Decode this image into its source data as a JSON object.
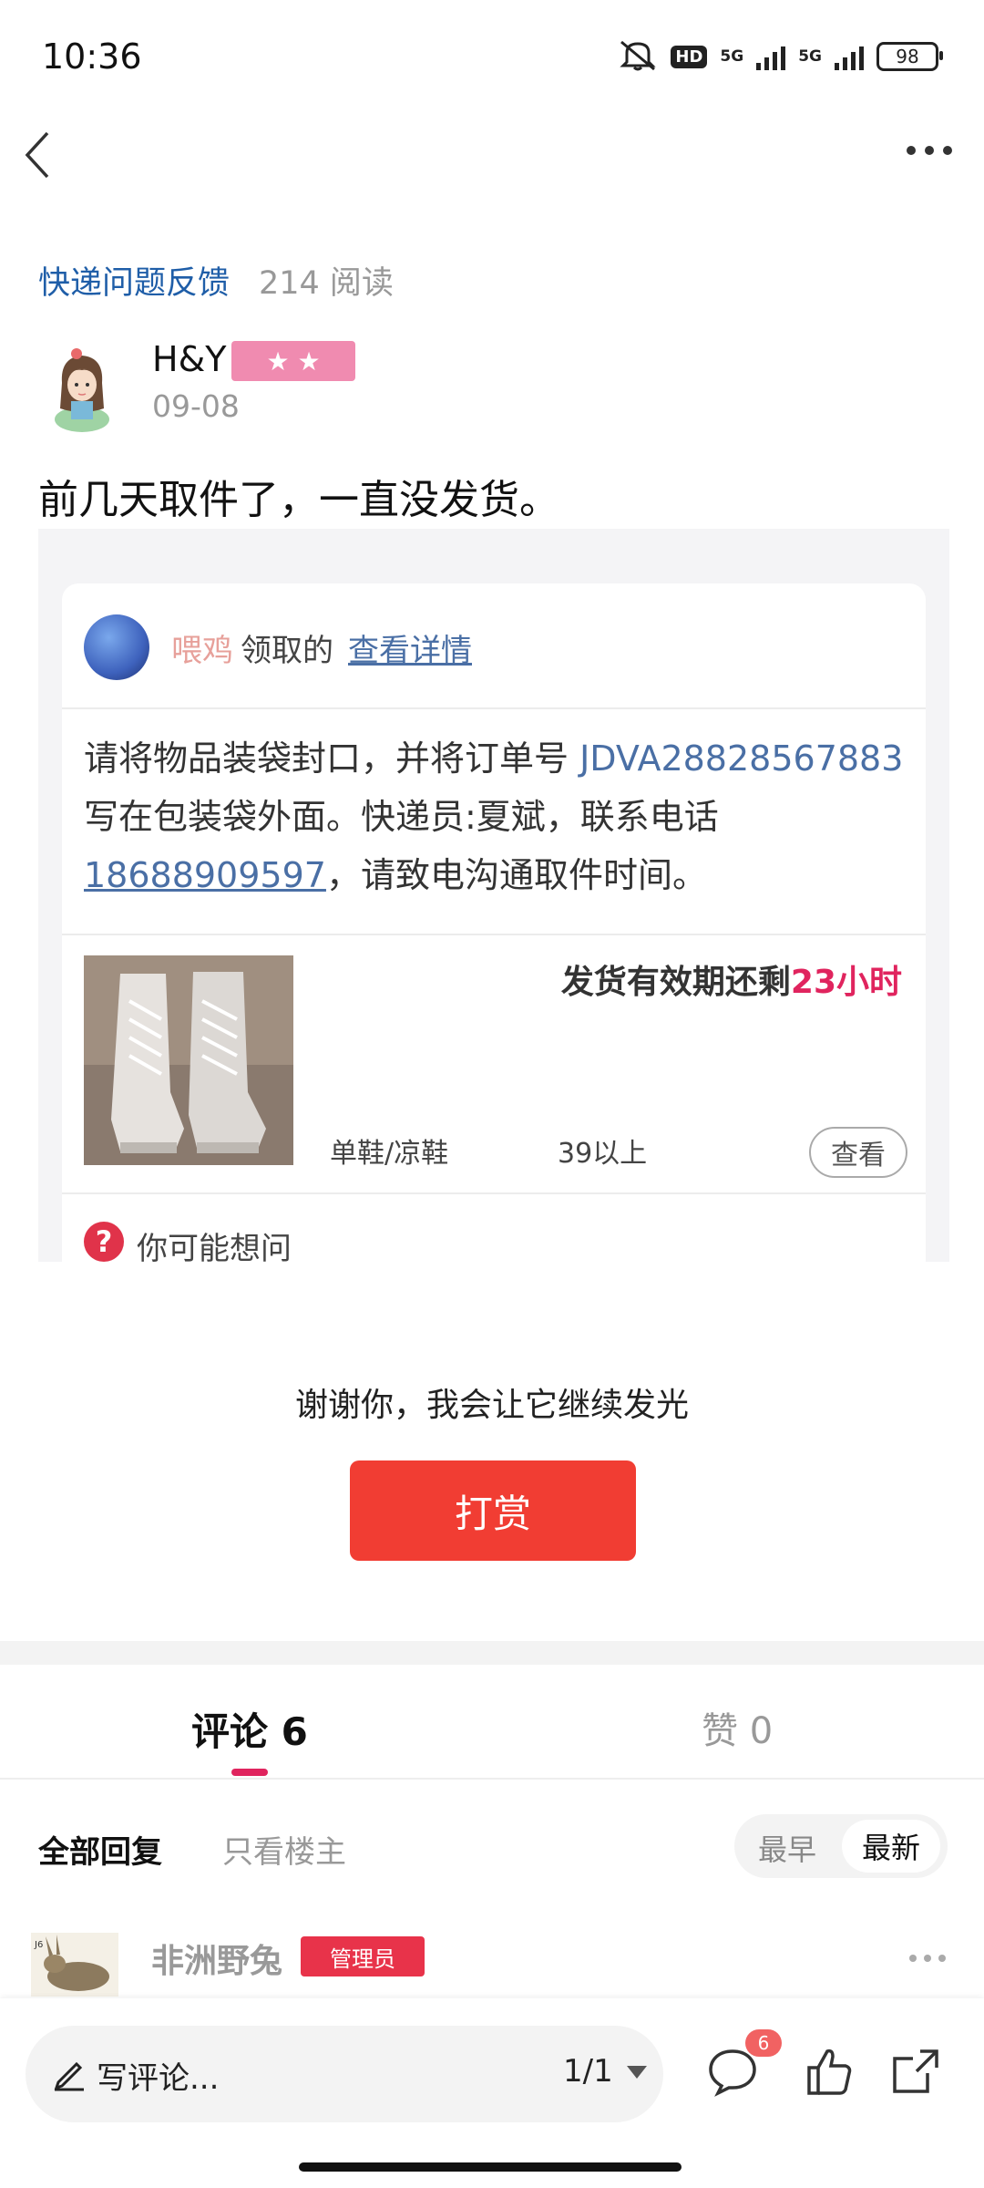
{
  "status_bar": {
    "time": "10:36",
    "hd_label": "HD",
    "net1": "5G",
    "net2": "5G",
    "battery": "98",
    "icons": [
      "mute-icon",
      "signal-icon",
      "battery-icon"
    ]
  },
  "post": {
    "topic": "快递问题反馈",
    "reads": "214 阅读",
    "author": "H&Y",
    "level_stars": "★ ★",
    "date": "09-08",
    "text": "前几天取件了，一直没发货。"
  },
  "card": {
    "claimer": "喂鸡",
    "claimed": "领取的",
    "detail_link": "查看详情",
    "instr_a": "请将物品装袋封口，并将订单号 ",
    "order_no": "JDVA28828567883",
    "instr_b": " 写在包装袋外面。快递员:夏斌，联系电话",
    "phone": "18688909597",
    "instr_c": "，请致电沟通取件时间。",
    "valid_prefix": "发货有效期还剩",
    "valid_time": "23小时",
    "category": "单鞋/凉鞋",
    "size": "39以上",
    "view_btn": "查看",
    "ask": "你可能想问"
  },
  "reward": {
    "thanks": "谢谢你，我会让它继续发光",
    "button": "打赏"
  },
  "tabs": {
    "comments": "评论 6",
    "likes": "赞 0"
  },
  "filters": {
    "all": "全部回复",
    "op_only": "只看楼主",
    "oldest": "最早",
    "newest": "最新"
  },
  "comment": {
    "name": "非洲野兔",
    "badge": "管理员"
  },
  "bottom": {
    "placeholder": "写评论...",
    "page": "1/1",
    "comment_count": "6"
  },
  "colors": {
    "accent": "#e0245e",
    "tip_button": "#f13d33",
    "link": "#1f5ea8"
  }
}
